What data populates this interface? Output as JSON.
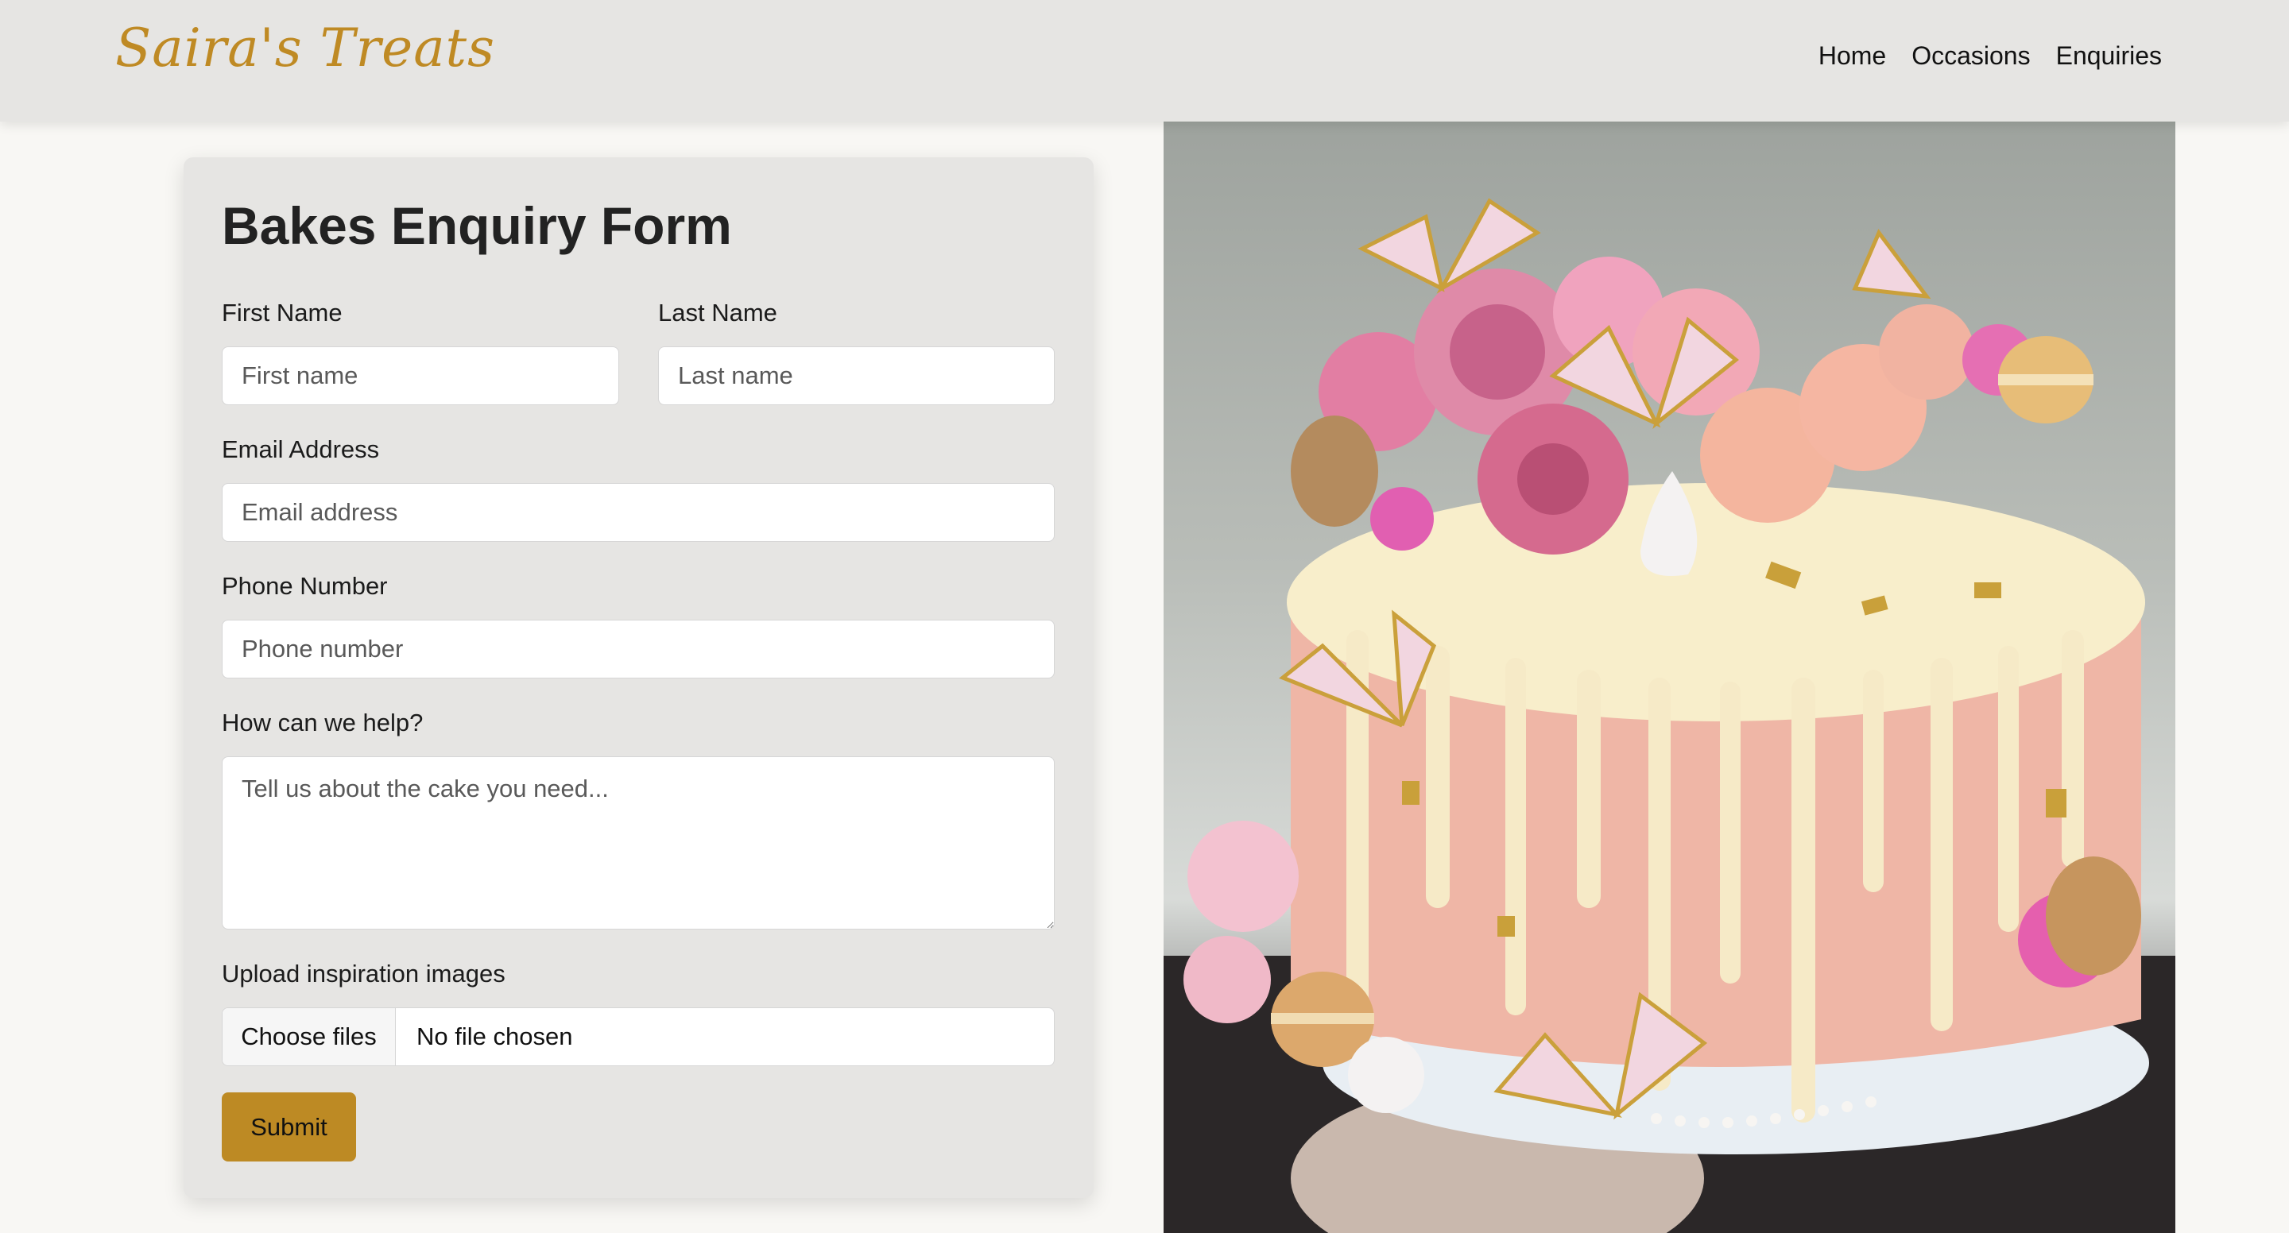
{
  "brand": {
    "name": "Saira's Treats"
  },
  "nav": {
    "items": [
      "Home",
      "Occasions",
      "Enquiries"
    ]
  },
  "form": {
    "title": "Bakes Enquiry Form",
    "first_name": {
      "label": "First Name",
      "placeholder": "First name"
    },
    "last_name": {
      "label": "Last Name",
      "placeholder": "Last name"
    },
    "email": {
      "label": "Email Address",
      "placeholder": "Email address"
    },
    "phone": {
      "label": "Phone Number",
      "placeholder": "Phone number"
    },
    "message": {
      "label": "How can we help?",
      "placeholder": "Tell us about the cake you need..."
    },
    "upload": {
      "label": "Upload inspiration images",
      "button": "Choose files",
      "status": "No file chosen"
    },
    "submit": "Submit"
  },
  "colors": {
    "accent": "#bd8a24",
    "navbar_bg": "#e6e5e3",
    "card_bg": "#e6e5e3",
    "page_bg": "#f8f7f4"
  },
  "image": {
    "subject": "pink drip cake with flowers, macarons and butterflies"
  }
}
